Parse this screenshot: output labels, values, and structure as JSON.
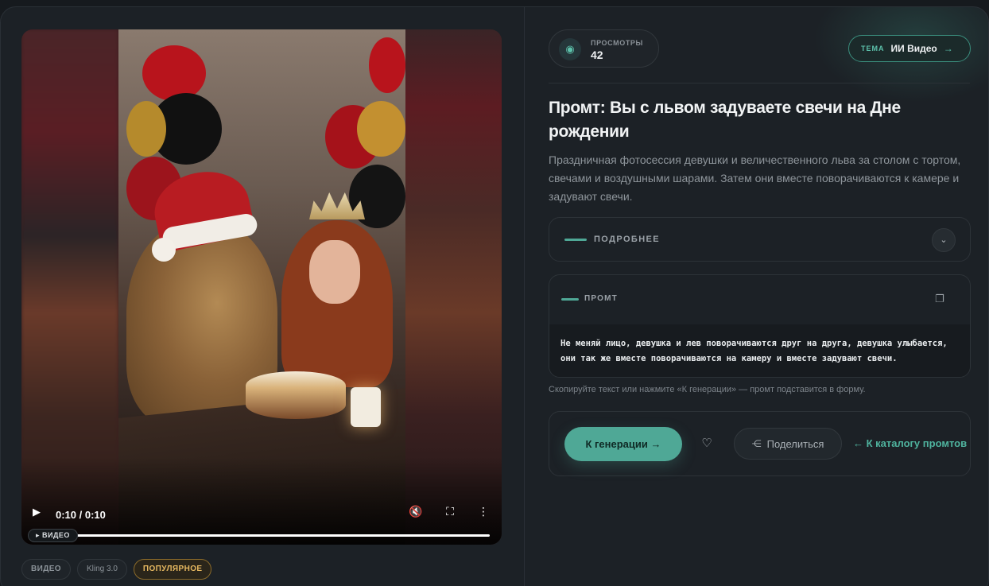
{
  "video": {
    "time": "0:10 / 0:10",
    "chip_label": "ВИДЕО",
    "progress_fraction": 1.0
  },
  "tags": [
    "ВИДЕО",
    "Kling 3.0",
    "ПОПУЛЯРНОЕ"
  ],
  "views": {
    "label": "ПРОСМОТРЫ",
    "value": "42",
    "icon": "eye-icon"
  },
  "theme": {
    "label": "ТЕМА",
    "value": "ИИ Видео",
    "icon": "arrow-right-icon"
  },
  "title": "Промт: Вы с львом задуваете свечи на Дне рождении",
  "description": "Праздничная фотосессия девушки и величественного льва за столом с тортом, свечами и воздушными шарами. Затем они вместе поворачиваются к камере и задувают свечи.",
  "more": {
    "label": "ПОДРОБНЕЕ",
    "icon": "chevron-down-icon"
  },
  "prompt": {
    "label": "ПРОМТ",
    "text": "Не меняй лицо, девушка и лев поворачиваются друг на друга, девушка улыбается, они так же вместе поворачиваются на камеру и вместе задувают свечи.",
    "icon": "copy-icon"
  },
  "hint": "Скопируйте текст или нажмите «К генерации» — промт подставится в форму.",
  "actions": {
    "generate_label": "К генерации",
    "share_label": "Поделиться",
    "catalog_label": "← К каталогу промтов"
  },
  "colors": {
    "accent": "#4fa896",
    "popular": "#e6b860",
    "background": "#1c2126"
  }
}
